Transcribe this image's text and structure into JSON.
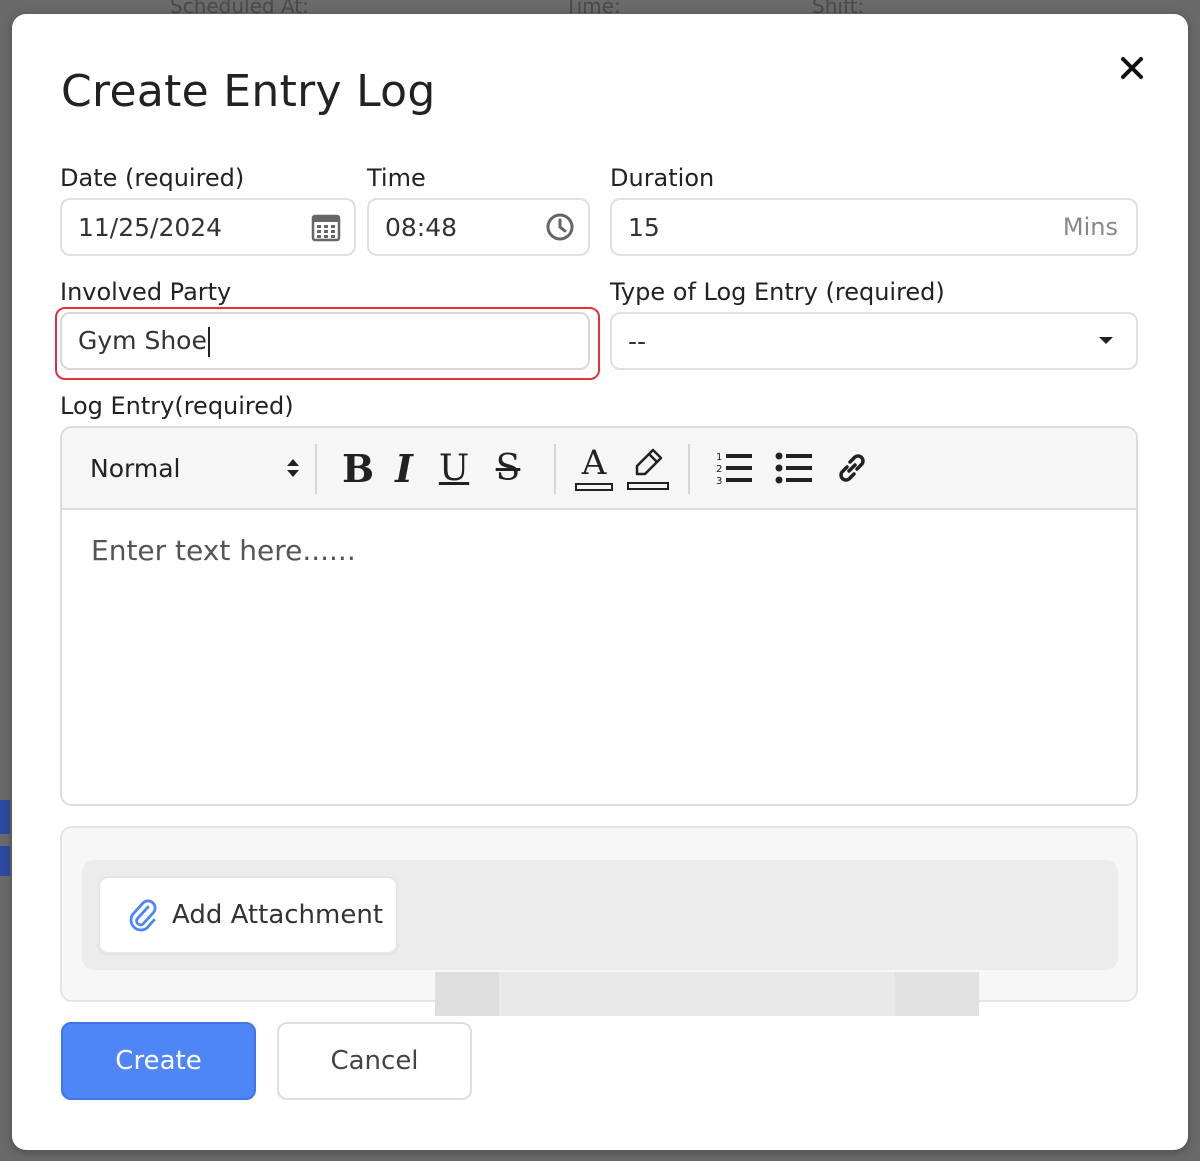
{
  "background": {
    "columns": [
      "Scheduled At:",
      "Time:",
      "Shift:"
    ]
  },
  "modal": {
    "title": "Create Entry Log",
    "close_icon": "close-icon"
  },
  "fields": {
    "date": {
      "label": "Date (required)",
      "value": "11/25/2024",
      "icon": "calendar-icon"
    },
    "time": {
      "label": "Time",
      "value": "08:48",
      "icon": "clock-icon"
    },
    "duration": {
      "label": "Duration",
      "value": "15",
      "suffix": "Mins"
    },
    "involved_party": {
      "label": "Involved Party",
      "value": "Gym Shoe"
    },
    "log_type": {
      "label": "Type of Log Entry (required)",
      "value": "--",
      "icon": "caret-down-icon"
    },
    "log_entry": {
      "label": "Log Entry(required)",
      "placeholder": "Enter text here......"
    }
  },
  "toolbar": {
    "format": "Normal",
    "bold": "B",
    "italic": "I",
    "underline": "U",
    "strike": "S",
    "font_color": "A",
    "icons": [
      "bold-icon",
      "italic-icon",
      "underline-icon",
      "strikethrough-icon",
      "font-color-icon",
      "highlight-icon",
      "ordered-list-icon",
      "bullet-list-icon",
      "link-icon"
    ]
  },
  "attachment": {
    "button_label": "Add Attachment",
    "icon": "paperclip-icon"
  },
  "actions": {
    "create": "Create",
    "cancel": "Cancel"
  },
  "colors": {
    "primary": "#4f86f7",
    "focus_ring": "#e0323f"
  }
}
